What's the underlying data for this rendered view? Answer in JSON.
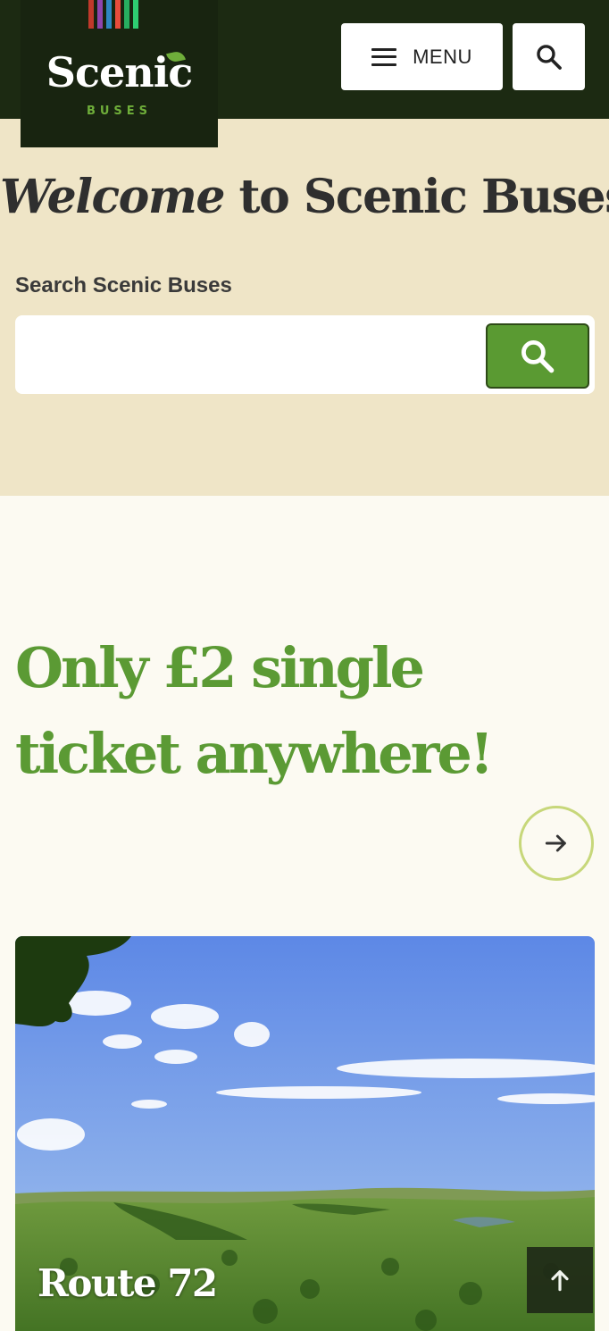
{
  "header": {
    "logo": {
      "name": "Scenic",
      "subtitle": "BUSES",
      "stripe_colors": [
        "#c0392b",
        "#8e44ad",
        "#2e86c1",
        "#e74c3c",
        "#27ae60",
        "#2ecc71"
      ]
    },
    "menu_label": "MENU",
    "search_icon": "search-icon",
    "menu_icon": "hamburger-icon"
  },
  "welcome": {
    "title_emphasis": "Welcome",
    "title_rest": " to Scenic Buses",
    "search_label": "Search Scenic Buses",
    "search_value": "",
    "search_placeholder": ""
  },
  "promo": {
    "text": "Only £2 single ticket anywhere!",
    "arrow_icon": "arrow-right-icon"
  },
  "route_card": {
    "title": "Route 72",
    "image": "landscape-valley-photo"
  },
  "back_to_top_icon": "arrow-up-icon",
  "colors": {
    "header_bg": "#1c2a12",
    "band_bg": "#efe5c7",
    "page_bg": "#fcfaf2",
    "accent_green": "#5b9a34",
    "arrow_ring": "#c7d77a"
  }
}
